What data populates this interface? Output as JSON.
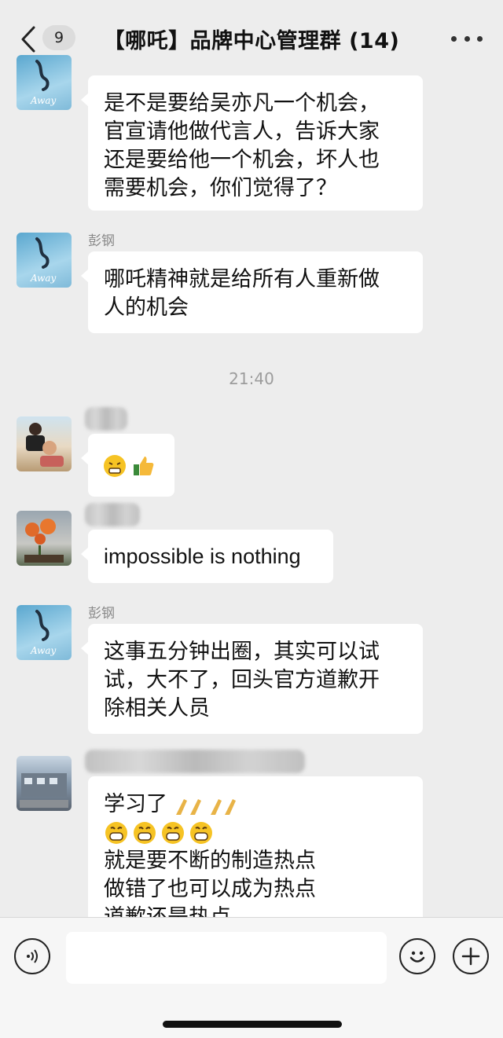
{
  "header": {
    "back_count": "9",
    "title": "【哪吒】品牌中心管理群 (14)"
  },
  "messages": [
    {
      "sender": "",
      "text_lines": [
        "是不是要给吴亦凡一个机会，",
        "官宣请他做代言人，告诉大家",
        "还是要给他一个机会，坏人也",
        "需要机会，你们觉得了？"
      ]
    },
    {
      "sender": "彭钢",
      "text_lines": [
        "哪吒精神就是给所有人重新做",
        "人的机会"
      ]
    },
    {
      "sender": "",
      "text_lines": []
    },
    {
      "sender": "",
      "text_lines": [
        "impossible is nothing"
      ]
    },
    {
      "sender": "彭钢",
      "text_lines": [
        "这事五分钟出圈，其实可以试",
        "试，大不了，回头官方道歉开",
        "除相关人员"
      ]
    },
    {
      "sender": "",
      "text_lines": [
        "学习了",
        "",
        "就是要不断的制造热点",
        "做错了也可以成为热点",
        "道歉还是热点"
      ]
    }
  ],
  "timestamp": "21:40",
  "icons": {
    "back": "chevron-left-icon",
    "more": "more-dots-icon",
    "voice": "voice-icon",
    "emoji": "emoji-icon",
    "plus": "plus-icon"
  },
  "colors": {
    "background": "#ededed",
    "bubble": "#ffffff",
    "timestamp": "#9c9c9c"
  }
}
